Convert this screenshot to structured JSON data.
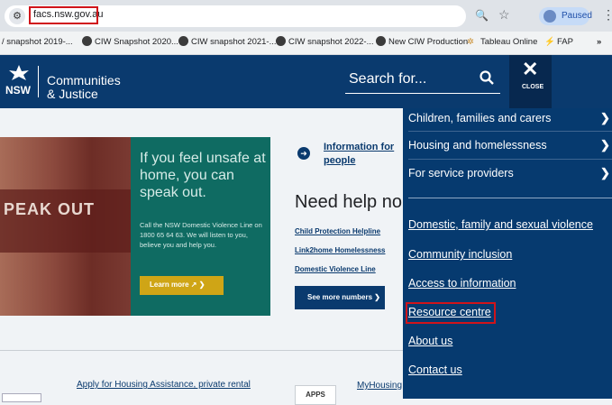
{
  "browser": {
    "url": "facs.nsw.gov.au",
    "profile_status": "Paused",
    "bookmarks": [
      "/ snapshot 2019-...",
      "CIW Snapshot 2020...",
      "CIW snapshot 2021-...",
      "CIW snapshot 2022-...",
      "New CIW Production",
      "Tableau Online",
      "FAP",
      "»"
    ]
  },
  "header": {
    "logo_text": "NSW",
    "brand_line1": "Communities",
    "brand_line2": "& Justice",
    "search_placeholder": "Search for...",
    "close_label": "CLOSE"
  },
  "hero": {
    "image_text": "PEAK OUT",
    "heading": "If you feel unsafe at home, you can speak out.",
    "body": "Call the NSW Domestic Violence Line on 1800 65 64 63. We will listen to you, believe you and help you.",
    "button": "Learn more ↗ ❯"
  },
  "info": {
    "link": "Information for people"
  },
  "help": {
    "heading": "Need help no",
    "links": [
      "Child Protection Helpline",
      "Link2home Homelessness",
      "Domestic Violence Line"
    ],
    "more_button": "See more numbers ❯"
  },
  "bottom": {
    "apply_text": "Apply for Housing Assistance, private rental",
    "apps_badge": "APPS",
    "myhousing": "MyHousing"
  },
  "menu": {
    "primary": [
      {
        "label": "Children, families and carers",
        "chevron": "❯"
      },
      {
        "label": "Housing and homelessness",
        "chevron": "❯"
      },
      {
        "label": "For service providers",
        "chevron": "❯"
      }
    ],
    "secondary": [
      "Domestic, family and sexual violence",
      "Community inclusion",
      "Access to information",
      "Resource centre",
      "About us",
      "Contact us"
    ]
  },
  "colors": {
    "brand_navy": "#0a3a6e",
    "menu_bg": "#063a6f",
    "hero_teal": "#0f6b62",
    "learn_gold": "#cfa516",
    "highlight_red": "#d0141a"
  }
}
